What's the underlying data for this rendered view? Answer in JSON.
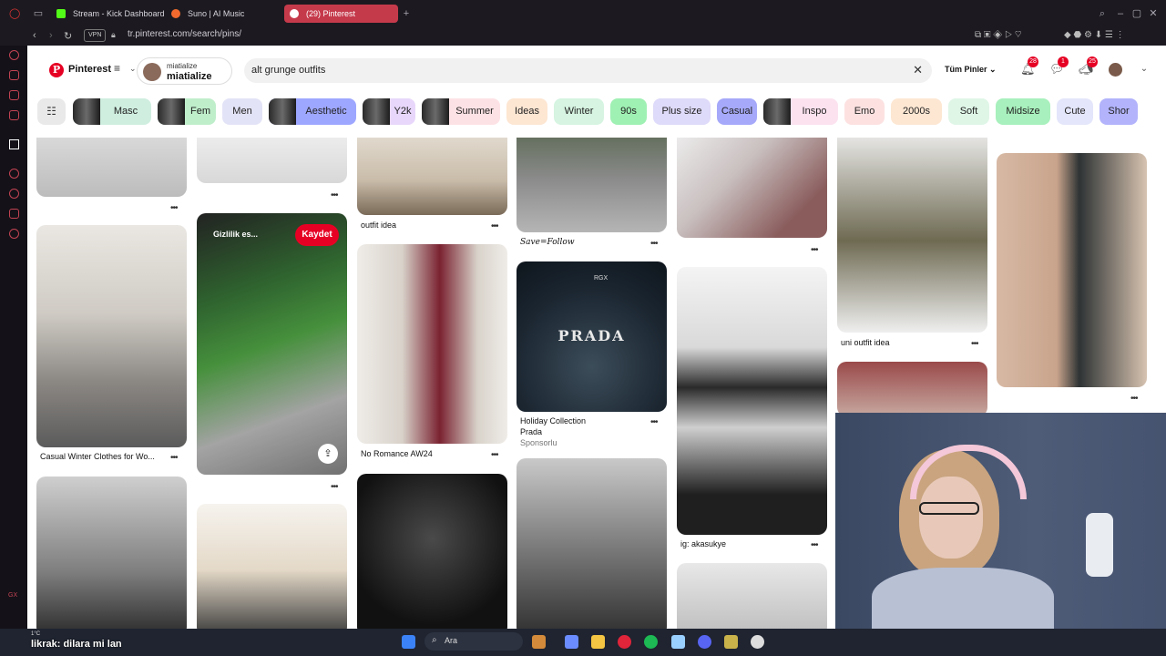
{
  "browser": {
    "tabs": [
      {
        "label": "Stream - Kick Dashboard",
        "color": "#53fc18"
      },
      {
        "label": "Suno | AI Music",
        "color": "#f26a2e"
      },
      {
        "label": "(29) Pinterest",
        "color": "#e60023",
        "active": true
      }
    ],
    "vpn_label": "VPN",
    "url": "tr.pinterest.com/search/pins/"
  },
  "header": {
    "brand": "Pinterest",
    "account_small": "miatialize",
    "account_name": "miatialize",
    "search_value": "alt grunge outfits",
    "scope_label": "Tüm Pinler",
    "badges": {
      "notifications": "28",
      "messages": "1",
      "updates": "25"
    }
  },
  "chips": [
    {
      "label": "Masc",
      "bg": "#cfeee0"
    },
    {
      "label": "Fem",
      "bg": "#bfeecb"
    },
    {
      "label": "Men",
      "bg": "#e3e3f7"
    },
    {
      "label": "Aesthetic",
      "bg": "#9ea7ff"
    },
    {
      "label": "Y2k",
      "bg": "#e8d7fb"
    },
    {
      "label": "Summer",
      "bg": "#fde2e5"
    },
    {
      "label": "Ideas",
      "bg": "#fde6d2"
    },
    {
      "label": "Winter",
      "bg": "#d6f4e1"
    },
    {
      "label": "90s",
      "bg": "#9ff0b3"
    },
    {
      "label": "Plus size",
      "bg": "#dedaf9"
    },
    {
      "label": "Casual",
      "bg": "#a6a9f9"
    },
    {
      "label": "Inspo",
      "bg": "#fce2ef"
    },
    {
      "label": "Emo",
      "bg": "#fde1e1"
    },
    {
      "label": "2000s",
      "bg": "#fde7d3"
    },
    {
      "label": "Soft",
      "bg": "#dff6e7"
    },
    {
      "label": "Midsize",
      "bg": "#a8f0bd"
    },
    {
      "label": "Cute",
      "bg": "#e4e6fb"
    },
    {
      "label": "Shor",
      "bg": "#b2b3fb"
    }
  ],
  "pins": {
    "captions": {
      "outfit_idea": "outfit idea",
      "save_follow": "Save=Follow",
      "uni_outfit_idea": "uni outfit idea",
      "casual_winter": "Casual Winter Clothes for Wo...",
      "no_romance": "No Romance AW24",
      "holiday": "Holiday Collection",
      "prada_sub": "Prada",
      "sponsored": "Sponsorlu",
      "akasukye": "ig: akasukye"
    },
    "overlay": {
      "save_label": "Kaydet",
      "board_label": "Gizlilik es..."
    },
    "ad": {
      "brand_word": "PRADA",
      "tag": "RGX"
    }
  },
  "stream": {
    "chat_line": "likrak: dilara mi lan",
    "temperature": "1°C"
  },
  "taskbar": {
    "search_label": "Ara"
  }
}
